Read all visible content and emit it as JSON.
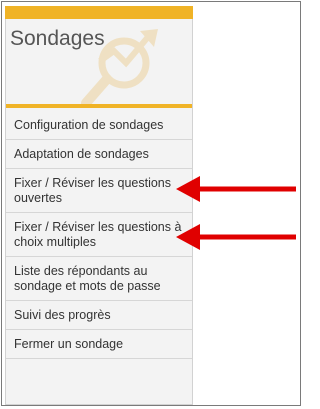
{
  "panel": {
    "title": "Sondages",
    "header_icon": "chart-magnifier-icon",
    "accent_color": "#f0b326"
  },
  "menu": {
    "items": [
      {
        "label": "Configuration de sondages"
      },
      {
        "label": "Adaptation de sondages"
      },
      {
        "label": "Fixer / Réviser les questions ouvertes"
      },
      {
        "label": "Fixer / Réviser les questions à choix multiples"
      },
      {
        "label": "Liste des répondants au sondage et mots de passe"
      },
      {
        "label": "Suivi des progrès"
      },
      {
        "label": "Fermer un sondage"
      }
    ]
  },
  "annotations": {
    "arrow_color": "#e00000",
    "arrow_icon": "red-left-arrow-icon"
  }
}
